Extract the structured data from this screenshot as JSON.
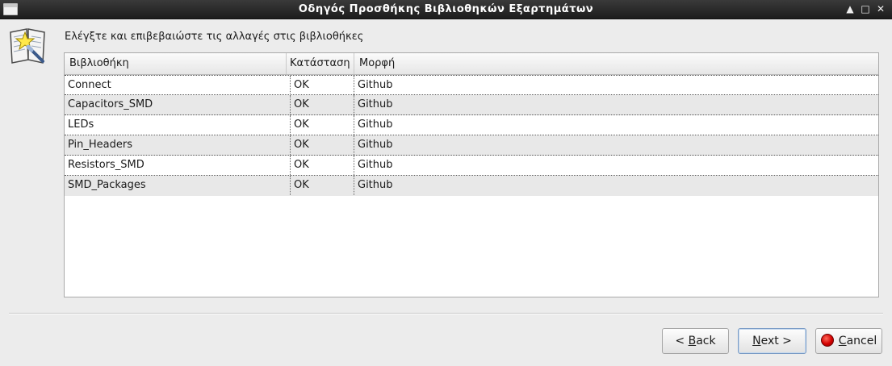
{
  "window": {
    "title": "Οδηγός Προσθήκης Βιβλιοθηκών Εξαρτημάτων",
    "controls": {
      "up": "▲",
      "restore": "□",
      "close": "✕"
    }
  },
  "instruction": "Ελέγξτε και επιβεβαιώστε τις αλλαγές στις βιβλιοθήκες",
  "table": {
    "columns": [
      "Βιβλιοθήκη",
      "Κατάσταση",
      "Μορφή"
    ],
    "rows": [
      {
        "library": "Connect",
        "status": "OK",
        "format": "Github"
      },
      {
        "library": "Capacitors_SMD",
        "status": "OK",
        "format": "Github"
      },
      {
        "library": "LEDs",
        "status": "OK",
        "format": "Github"
      },
      {
        "library": "Pin_Headers",
        "status": "OK",
        "format": "Github"
      },
      {
        "library": "Resistors_SMD",
        "status": "OK",
        "format": "Github"
      },
      {
        "library": "SMD_Packages",
        "status": "OK",
        "format": "Github"
      }
    ]
  },
  "buttons": {
    "back_prefix": "< ",
    "back_mnemonic": "B",
    "back_rest": "ack",
    "next_mnemonic": "N",
    "next_rest": "ext >",
    "cancel_mnemonic": "C",
    "cancel_rest": "ancel"
  },
  "colors": {
    "titlebar": "#1c1c1c",
    "row_alt": "#e8e8e8",
    "cancel_icon": "#d30000"
  }
}
